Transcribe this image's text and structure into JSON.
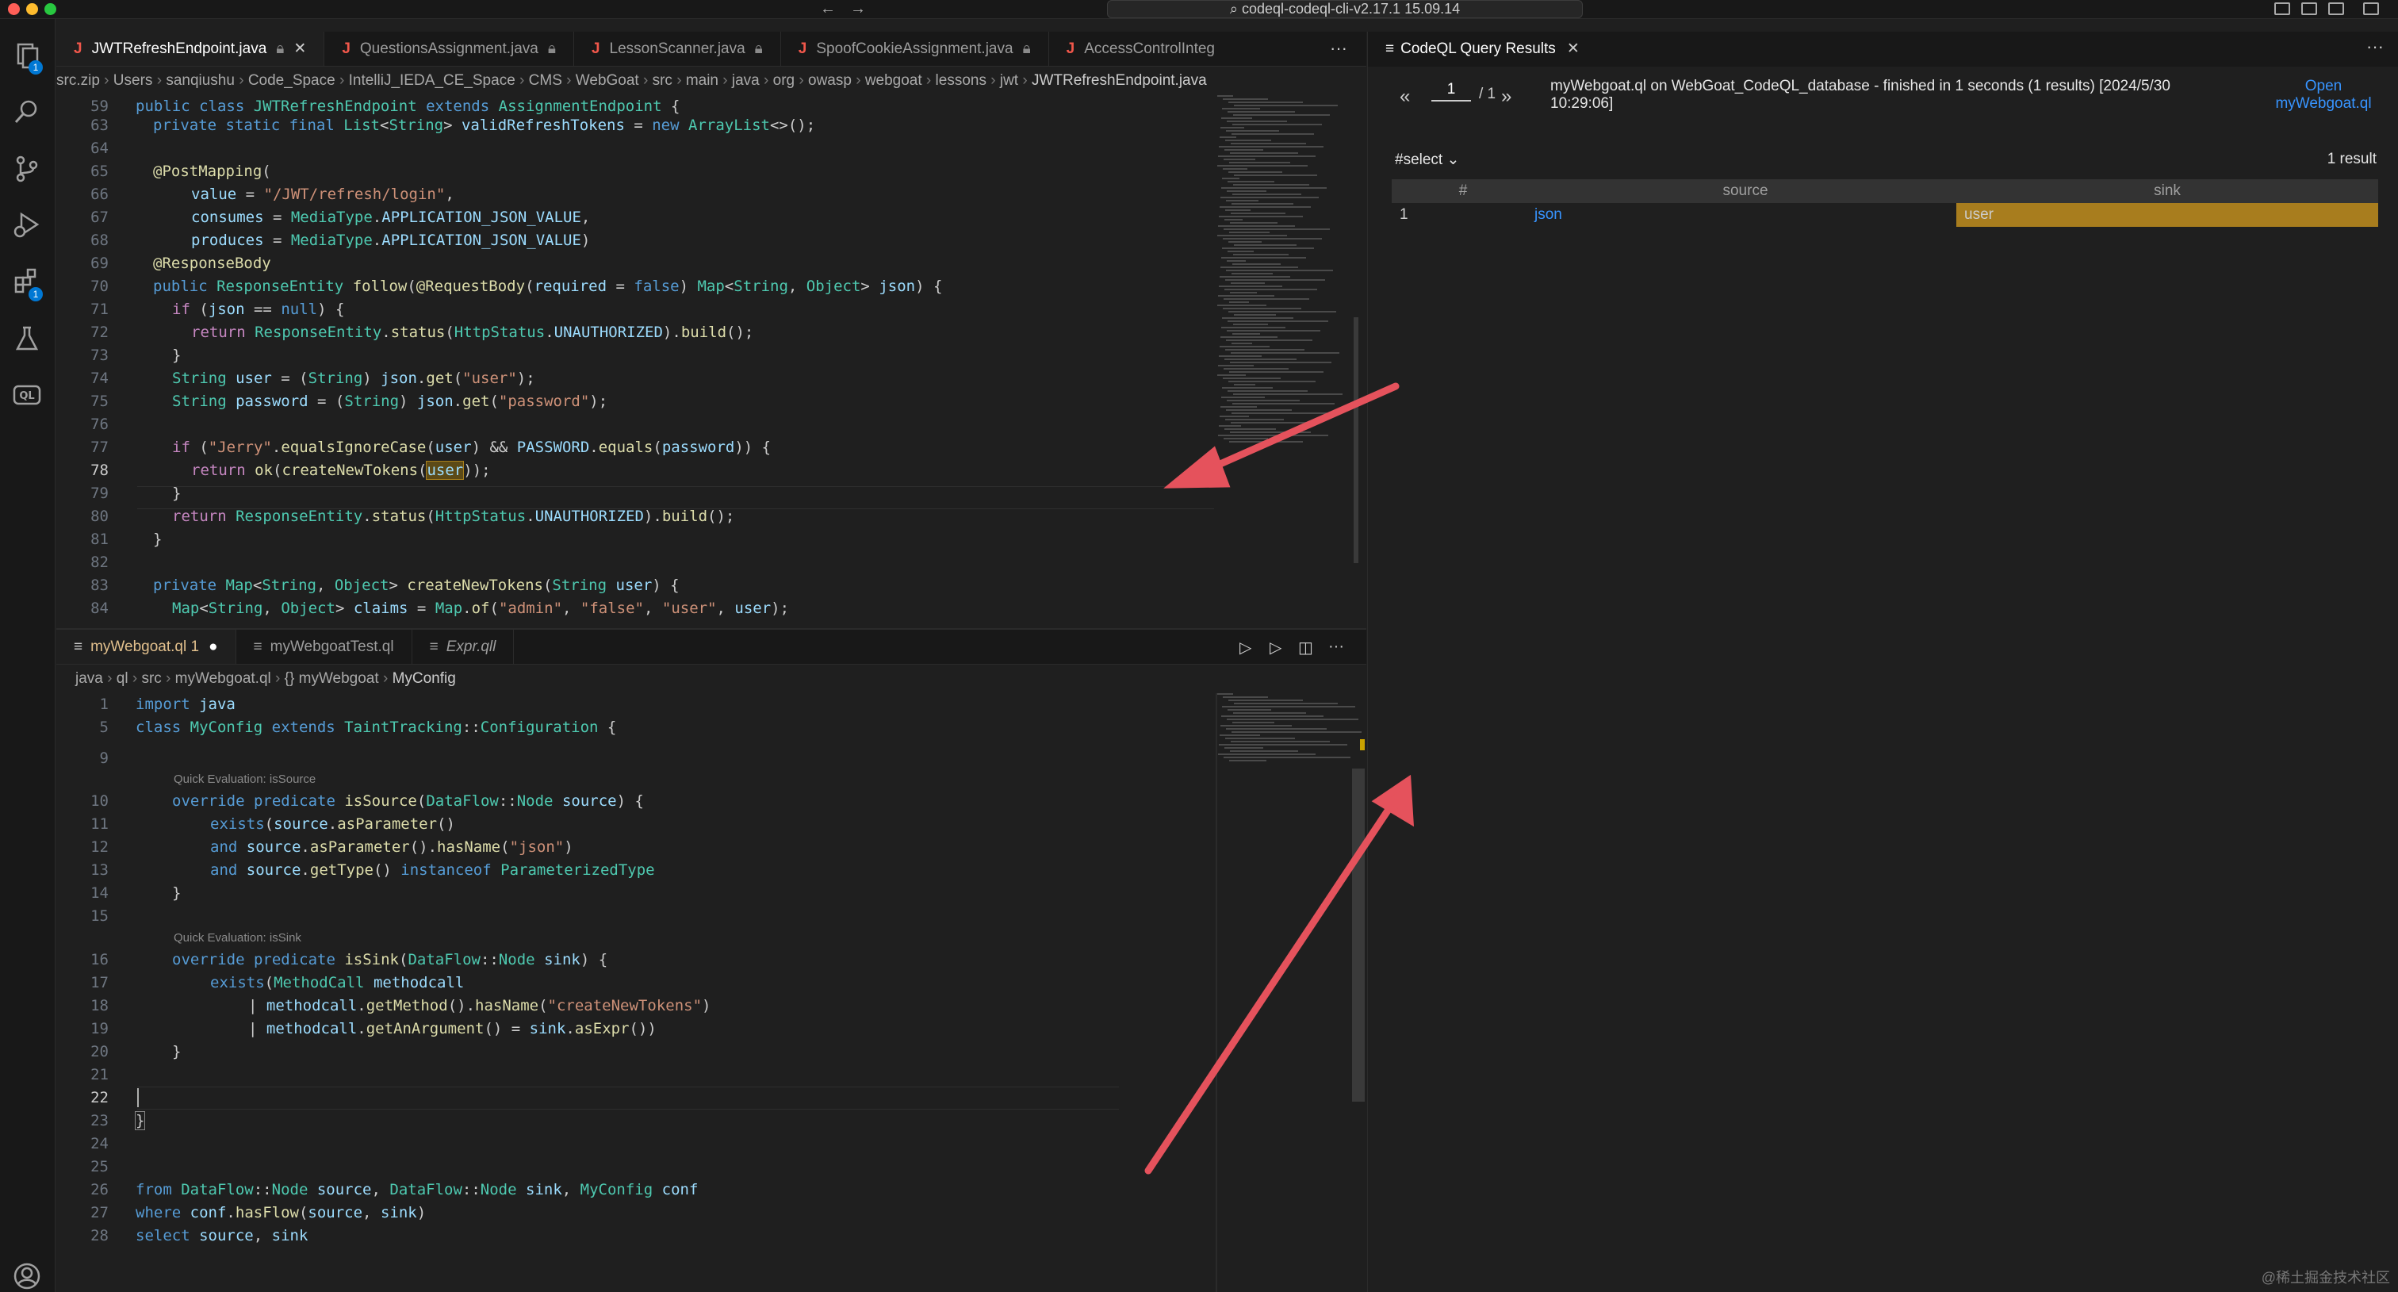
{
  "titlebar": {
    "command_center": "codeql-codeql-cli-v2.17.1 15.09.14"
  },
  "top_editor": {
    "tabs": [
      {
        "label": "JWTRefreshEndpoint.java",
        "active": true,
        "locked": true,
        "closable": true
      },
      {
        "label": "QuestionsAssignment.java",
        "locked": true
      },
      {
        "label": "LessonScanner.java",
        "locked": true
      },
      {
        "label": "SpoofCookieAssignment.java",
        "locked": true
      },
      {
        "label": "AccessControlInteg"
      }
    ],
    "tabs_more": "···",
    "breadcrumb": [
      "src.zip",
      "Users",
      "sanqiushu",
      "Code_Space",
      "IntelliJ_IEDA_CE_Space",
      "CMS",
      "WebGoat",
      "src",
      "main",
      "java",
      "org",
      "owasp",
      "webgoat",
      "lessons",
      "jwt",
      "JWTRefreshEndpoint.java"
    ],
    "current_line": "78"
  },
  "bottom_editor": {
    "tabs": [
      {
        "label": "myWebgoat.ql",
        "badge": "1",
        "modified": true,
        "active": true
      },
      {
        "label": "myWebgoatTest.ql"
      },
      {
        "label": "Expr.qll"
      }
    ],
    "breadcrumb": [
      "java",
      "ql",
      "src",
      "myWebgoat.ql",
      "{} myWebgoat",
      "MyConfig"
    ],
    "codelens": [
      "Quick Evaluation: isSource",
      "Quick Evaluation: isSink"
    ],
    "current_line": "22"
  },
  "results_panel": {
    "tab_label": "CodeQL Query Results",
    "page_current": "1",
    "page_total": "/ 1",
    "summary": "myWebgoat.ql on WebGoat_CodeQL_database - finished in 1 seconds (1 results) [2024/5/30 10:29:06]",
    "open_link": "Open myWebgoat.ql",
    "select_label": "#select",
    "result_count": "1 result",
    "columns": [
      "#",
      "source",
      "sink"
    ],
    "rows": [
      {
        "index": "1",
        "source": "json",
        "sink": "user"
      }
    ]
  },
  "watermark": "@稀土掘金技术社区",
  "colors": {
    "accent": "#0078d4",
    "highlight": "#a87d1e",
    "arrow": "#e5525c"
  }
}
